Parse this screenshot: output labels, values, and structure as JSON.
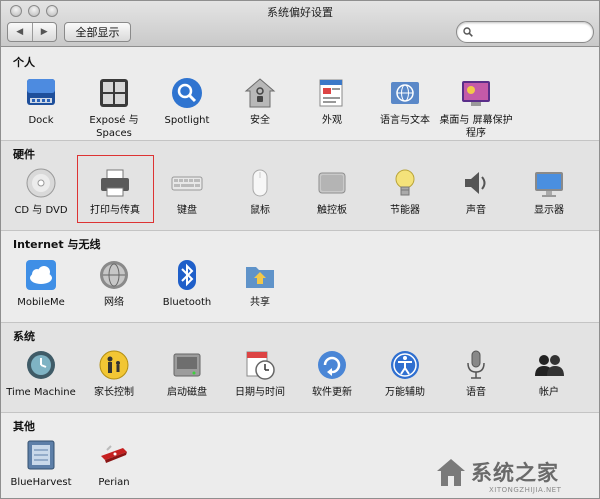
{
  "window": {
    "title": "系统偏好设置"
  },
  "toolbar": {
    "back_label": "◀",
    "forward_label": "▶",
    "show_all_label": "全部显示",
    "search_placeholder": ""
  },
  "sections": [
    {
      "title": "个人",
      "items": [
        {
          "label": "Dock",
          "icon": "dock-icon"
        },
        {
          "label": "Exposé 与 Spaces",
          "icon": "expose-icon"
        },
        {
          "label": "Spotlight",
          "icon": "spotlight-icon"
        },
        {
          "label": "安全",
          "icon": "security-icon"
        },
        {
          "label": "外观",
          "icon": "appearance-icon"
        },
        {
          "label": "语言与文本",
          "icon": "language-icon"
        },
        {
          "label": "桌面与 屏幕保护程序",
          "icon": "desktop-icon"
        }
      ]
    },
    {
      "title": "硬件",
      "items": [
        {
          "label": "CD 与 DVD",
          "icon": "cd-dvd-icon"
        },
        {
          "label": "打印与传真",
          "icon": "printer-icon"
        },
        {
          "label": "键盘",
          "icon": "keyboard-icon"
        },
        {
          "label": "鼠标",
          "icon": "mouse-icon"
        },
        {
          "label": "触控板",
          "icon": "trackpad-icon"
        },
        {
          "label": "节能器",
          "icon": "energy-saver-icon"
        },
        {
          "label": "声音",
          "icon": "sound-icon"
        },
        {
          "label": "显示器",
          "icon": "display-icon"
        }
      ]
    },
    {
      "title": "Internet 与无线",
      "items": [
        {
          "label": "MobileMe",
          "icon": "mobileme-icon"
        },
        {
          "label": "网络",
          "icon": "network-icon"
        },
        {
          "label": "Bluetooth",
          "icon": "bluetooth-icon"
        },
        {
          "label": "共享",
          "icon": "sharing-icon"
        }
      ]
    },
    {
      "title": "系统",
      "items": [
        {
          "label": "Time Machine",
          "icon": "time-machine-icon"
        },
        {
          "label": "家长控制",
          "icon": "parental-controls-icon"
        },
        {
          "label": "启动磁盘",
          "icon": "startup-disk-icon"
        },
        {
          "label": "日期与时间",
          "icon": "date-time-icon"
        },
        {
          "label": "软件更新",
          "icon": "software-update-icon"
        },
        {
          "label": "万能辅助",
          "icon": "universal-access-icon"
        },
        {
          "label": "语音",
          "icon": "speech-icon"
        },
        {
          "label": "帐户",
          "icon": "accounts-icon"
        }
      ]
    },
    {
      "title": "其他",
      "items": [
        {
          "label": "BlueHarvest",
          "icon": "blueharvest-icon"
        },
        {
          "label": "Perian",
          "icon": "perian-icon"
        }
      ]
    }
  ],
  "selected_item": "打印与传真",
  "watermark": {
    "text": "系统之家",
    "sub": "XITONGZHIJIA.NET"
  },
  "colors": {
    "accent_blue": "#2f74d0",
    "highlight_red": "#dd3333"
  }
}
